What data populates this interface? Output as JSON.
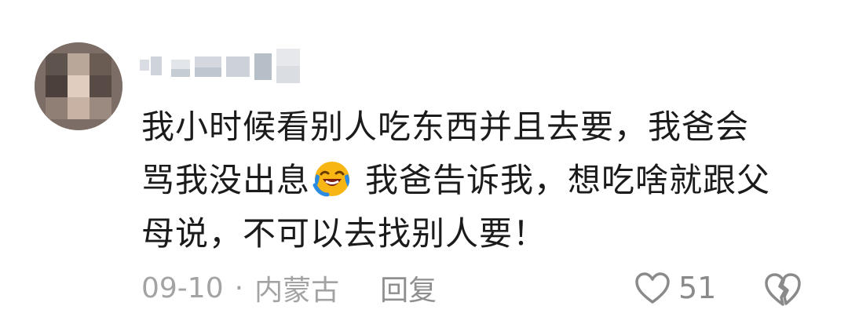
{
  "comment": {
    "user": {
      "name_is_pixelated": true,
      "avatar_is_pixelated": true
    },
    "text_line1": "我小时候看别人吃东西并且去要，我爸会",
    "text_line2_part1": "骂我没出息",
    "emoji": "laughing-crying-emoji",
    "text_line2_part2": "我爸告诉我，想吃啥就跟父",
    "text_line3": "母说，不可以去找别人要！",
    "date": "09-10",
    "separator": "·",
    "location": "内蒙古",
    "reply_label": "回复",
    "like_count": "51"
  },
  "colors": {
    "text": "#1b1b1b",
    "meta": "#a3a3a3",
    "icon": "#8a8a8a",
    "emoji_yellow": "#f7b614",
    "emoji_blue": "#2b8be0"
  }
}
